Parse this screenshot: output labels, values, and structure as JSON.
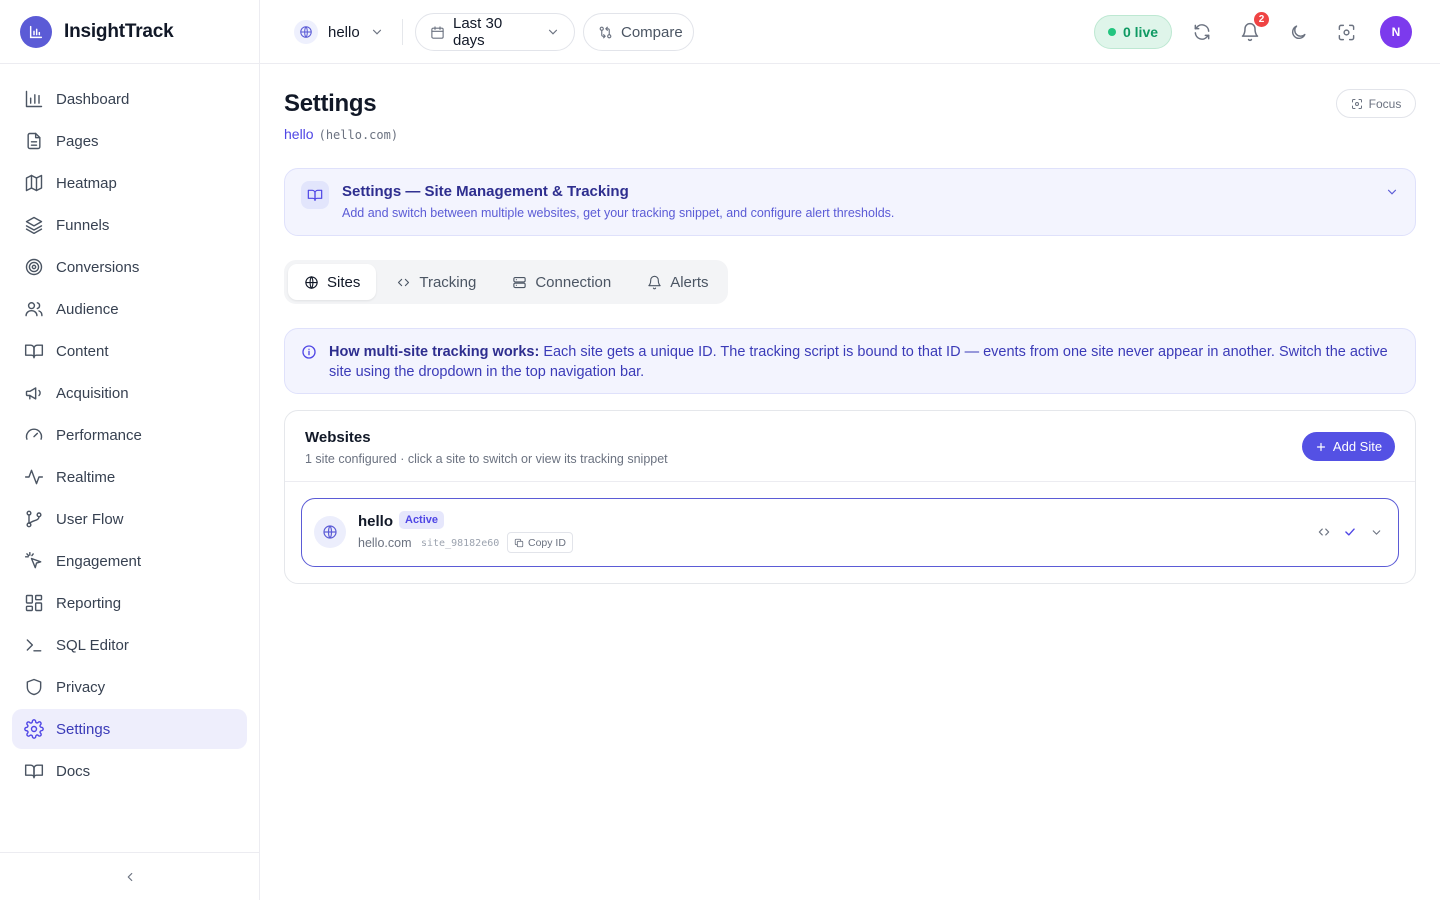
{
  "app": {
    "name": "InsightTrack"
  },
  "sidebar": {
    "items": [
      {
        "label": "Dashboard",
        "icon": "bar-chart-icon"
      },
      {
        "label": "Pages",
        "icon": "file-icon"
      },
      {
        "label": "Heatmap",
        "icon": "map-icon"
      },
      {
        "label": "Funnels",
        "icon": "layers-icon"
      },
      {
        "label": "Conversions",
        "icon": "target-icon"
      },
      {
        "label": "Audience",
        "icon": "users-icon"
      },
      {
        "label": "Content",
        "icon": "book-icon"
      },
      {
        "label": "Acquisition",
        "icon": "megaphone-icon"
      },
      {
        "label": "Performance",
        "icon": "gauge-icon"
      },
      {
        "label": "Realtime",
        "icon": "activity-icon"
      },
      {
        "label": "User Flow",
        "icon": "git-branch-icon"
      },
      {
        "label": "Engagement",
        "icon": "pointer-click-icon"
      },
      {
        "label": "Reporting",
        "icon": "grid-icon"
      },
      {
        "label": "SQL Editor",
        "icon": "terminal-icon"
      },
      {
        "label": "Privacy",
        "icon": "shield-icon"
      },
      {
        "label": "Settings",
        "icon": "gear-icon",
        "active": true
      },
      {
        "label": "Docs",
        "icon": "book-icon"
      }
    ]
  },
  "topbar": {
    "site": "hello",
    "date_range": "Last 30 days",
    "compare": "Compare",
    "live": "0 live",
    "notifications": "2",
    "avatar_initial": "N"
  },
  "page": {
    "title": "Settings",
    "site_name": "hello",
    "site_domain": "(hello.com)",
    "focus": "Focus"
  },
  "info": {
    "title": "Settings — Site Management & Tracking",
    "description": "Add and switch between multiple websites, get your tracking snippet, and configure alert thresholds."
  },
  "tabs": [
    {
      "label": "Sites",
      "active": true
    },
    {
      "label": "Tracking"
    },
    {
      "label": "Connection"
    },
    {
      "label": "Alerts"
    }
  ],
  "notice": {
    "bold": "How multi-site tracking works:",
    "text": " Each site gets a unique ID. The tracking script is bound to that ID — events from one site never appear in another. Switch the active site using the dropdown in the top navigation bar."
  },
  "websites": {
    "title": "Websites",
    "subtitle": "1 site configured · click a site to switch or view its tracking snippet",
    "add_label": "Add Site",
    "sites": [
      {
        "name": "hello",
        "badge": "Active",
        "domain": "hello.com",
        "id": "site_98182e60",
        "copy_label": "Copy ID"
      }
    ]
  },
  "colors": {
    "accent": "#5451e4",
    "live": "#0f9a63",
    "badge": "#ef4444",
    "avatar": "#7c3aed"
  }
}
